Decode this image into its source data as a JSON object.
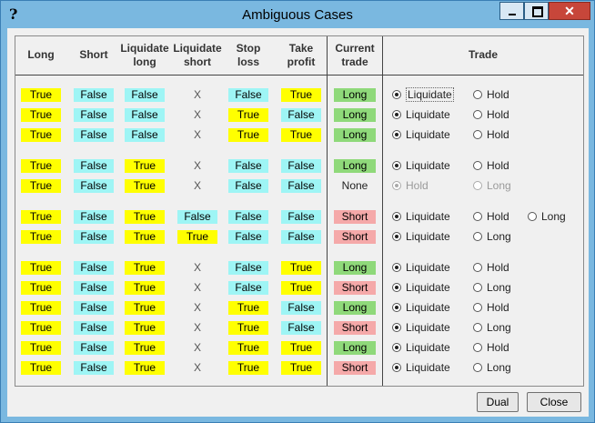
{
  "window": {
    "title": "Ambiguous Cases",
    "help_glyph": "?",
    "close_glyph": "✕"
  },
  "headers": [
    [
      "Long"
    ],
    [
      "Short"
    ],
    [
      "Liquidate",
      "long"
    ],
    [
      "Liquidate",
      "short"
    ],
    [
      "Stop",
      "loss"
    ],
    [
      "Take",
      "profit"
    ],
    [
      "Current",
      "trade"
    ],
    [
      "Trade"
    ]
  ],
  "rows": [
    {
      "cells": [
        "True",
        "False",
        "False",
        "X",
        "False",
        "True"
      ],
      "current": "Long",
      "trade": [
        {
          "label": "Liquidate",
          "selected": true,
          "enabled": true,
          "focused": true
        },
        {
          "label": "Hold",
          "selected": false,
          "enabled": true
        }
      ]
    },
    {
      "cells": [
        "True",
        "False",
        "False",
        "X",
        "True",
        "False"
      ],
      "current": "Long",
      "trade": [
        {
          "label": "Liquidate",
          "selected": true,
          "enabled": true
        },
        {
          "label": "Hold",
          "selected": false,
          "enabled": true
        }
      ]
    },
    {
      "cells": [
        "True",
        "False",
        "False",
        "X",
        "True",
        "True"
      ],
      "current": "Long",
      "trade": [
        {
          "label": "Liquidate",
          "selected": true,
          "enabled": true
        },
        {
          "label": "Hold",
          "selected": false,
          "enabled": true
        }
      ]
    },
    {
      "cells": [
        "True",
        "False",
        "True",
        "X",
        "False",
        "False"
      ],
      "current": "Long",
      "trade": [
        {
          "label": "Liquidate",
          "selected": true,
          "enabled": true
        },
        {
          "label": "Hold",
          "selected": false,
          "enabled": true
        }
      ]
    },
    {
      "cells": [
        "True",
        "False",
        "True",
        "X",
        "False",
        "False"
      ],
      "current": "None",
      "trade": [
        {
          "label": "Hold",
          "selected": true,
          "enabled": false
        },
        {
          "label": "Long",
          "selected": false,
          "enabled": false
        }
      ]
    },
    {
      "cells": [
        "True",
        "False",
        "True",
        "False",
        "False",
        "False"
      ],
      "current": "Short",
      "trade": [
        {
          "label": "Liquidate",
          "selected": true,
          "enabled": true
        },
        {
          "label": "Hold",
          "selected": false,
          "enabled": true
        },
        {
          "label": "Long",
          "selected": false,
          "enabled": true
        }
      ]
    },
    {
      "cells": [
        "True",
        "False",
        "True",
        "True",
        "False",
        "False"
      ],
      "current": "Short",
      "trade": [
        {
          "label": "Liquidate",
          "selected": true,
          "enabled": true
        },
        {
          "label": "Long",
          "selected": false,
          "enabled": true
        }
      ]
    },
    {
      "cells": [
        "True",
        "False",
        "True",
        "X",
        "False",
        "True"
      ],
      "current": "Long",
      "trade": [
        {
          "label": "Liquidate",
          "selected": true,
          "enabled": true
        },
        {
          "label": "Hold",
          "selected": false,
          "enabled": true
        }
      ]
    },
    {
      "cells": [
        "True",
        "False",
        "True",
        "X",
        "False",
        "True"
      ],
      "current": "Short",
      "trade": [
        {
          "label": "Liquidate",
          "selected": true,
          "enabled": true
        },
        {
          "label": "Long",
          "selected": false,
          "enabled": true
        }
      ]
    },
    {
      "cells": [
        "True",
        "False",
        "True",
        "X",
        "True",
        "False"
      ],
      "current": "Long",
      "trade": [
        {
          "label": "Liquidate",
          "selected": true,
          "enabled": true
        },
        {
          "label": "Hold",
          "selected": false,
          "enabled": true
        }
      ]
    },
    {
      "cells": [
        "True",
        "False",
        "True",
        "X",
        "True",
        "False"
      ],
      "current": "Short",
      "trade": [
        {
          "label": "Liquidate",
          "selected": true,
          "enabled": true
        },
        {
          "label": "Long",
          "selected": false,
          "enabled": true
        }
      ]
    },
    {
      "cells": [
        "True",
        "False",
        "True",
        "X",
        "True",
        "True"
      ],
      "current": "Long",
      "trade": [
        {
          "label": "Liquidate",
          "selected": true,
          "enabled": true
        },
        {
          "label": "Hold",
          "selected": false,
          "enabled": true
        }
      ]
    },
    {
      "cells": [
        "True",
        "False",
        "True",
        "X",
        "True",
        "True"
      ],
      "current": "Short",
      "trade": [
        {
          "label": "Liquidate",
          "selected": true,
          "enabled": true
        },
        {
          "label": "Long",
          "selected": false,
          "enabled": true
        }
      ]
    }
  ],
  "buttons": {
    "dual": "Dual",
    "close": "Close"
  },
  "colors": {
    "true": "#ffff00",
    "false": "#9ef5f5",
    "long": "#8fd97a",
    "short": "#f5a9a9",
    "titlebar": "#7ab8e0"
  }
}
